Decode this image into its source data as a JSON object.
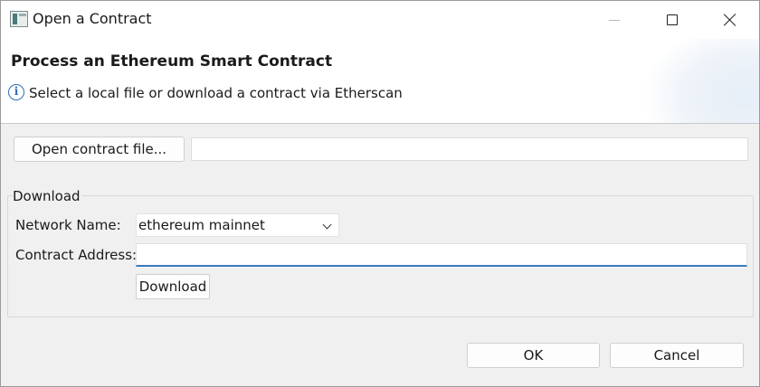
{
  "window": {
    "title": "Open a Contract",
    "controls": [
      "minimize",
      "maximize",
      "close"
    ]
  },
  "header": {
    "title": "Process an Ethereum Smart Contract",
    "message": "Select a local file or download a contract via Etherscan",
    "info_icon_glyph": "i"
  },
  "file": {
    "open_button_label": "Open contract file...",
    "path_value": ""
  },
  "download": {
    "group_label": "Download",
    "network_label": "Network Name:",
    "network_selected": "ethereum mainnet",
    "address_label": "Contract Address:",
    "address_value": "",
    "download_button_label": "Download"
  },
  "footer": {
    "ok_label": "OK",
    "cancel_label": "Cancel"
  },
  "colors": {
    "accent": "#3b7bbf",
    "info": "#2d6fb3",
    "dialog_bg": "#f0f0f0"
  }
}
